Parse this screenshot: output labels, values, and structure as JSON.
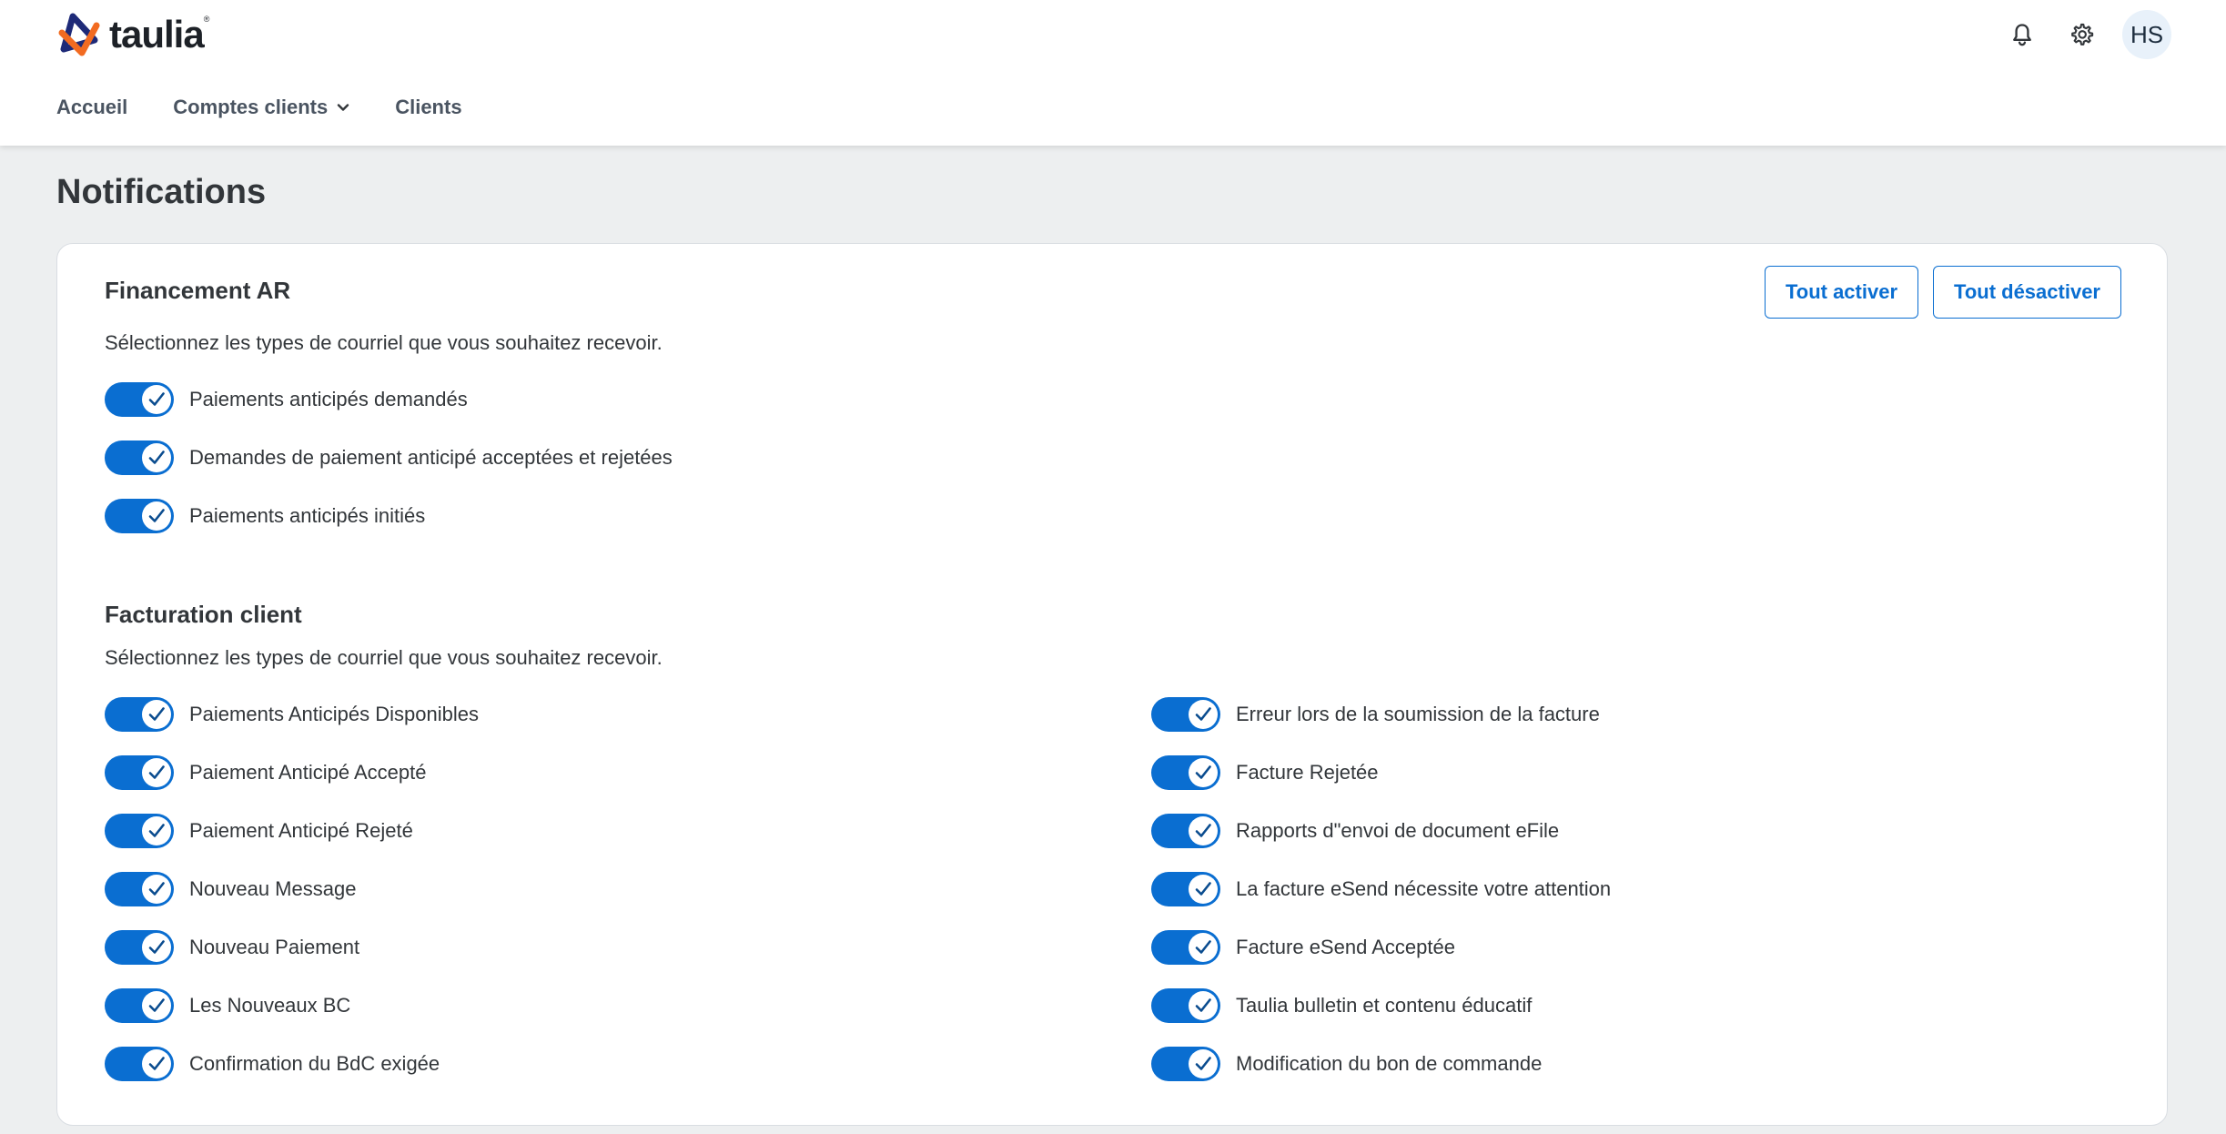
{
  "brand": {
    "name": "taulia",
    "mark": "®",
    "colors": {
      "orange": "#f26b21",
      "navy": "#1e2a78",
      "accent": "#0a6ed1"
    }
  },
  "header": {
    "bell_icon": "bell-icon",
    "settings_icon": "gear-icon",
    "avatar_initials": "HS"
  },
  "nav": {
    "items": [
      {
        "label": "Accueil"
      },
      {
        "label": "Comptes clients",
        "has_dropdown": true
      },
      {
        "label": "Clients"
      }
    ]
  },
  "page": {
    "title": "Notifications"
  },
  "actions": {
    "enable_all": "Tout activer",
    "disable_all": "Tout désactiver"
  },
  "sections": [
    {
      "title": "Financement AR",
      "description": "Sélectionnez les types de courriel que vous souhaitez recevoir.",
      "left": [
        {
          "label": "Paiements anticipés demandés",
          "enabled": true
        },
        {
          "label": "Demandes de paiement anticipé acceptées et rejetées",
          "enabled": true
        },
        {
          "label": "Paiements anticipés initiés",
          "enabled": true
        }
      ]
    },
    {
      "title": "Facturation client",
      "description": "Sélectionnez les types de courriel que vous souhaitez recevoir.",
      "left": [
        {
          "label": "Paiements Anticipés Disponibles",
          "enabled": true
        },
        {
          "label": "Paiement Anticipé Accepté",
          "enabled": true
        },
        {
          "label": "Paiement Anticipé Rejeté",
          "enabled": true
        },
        {
          "label": "Nouveau Message",
          "enabled": true
        },
        {
          "label": "Nouveau Paiement",
          "enabled": true
        },
        {
          "label": "Les Nouveaux BC",
          "enabled": true
        },
        {
          "label": "Confirmation du BdC exigée",
          "enabled": true
        }
      ],
      "right": [
        {
          "label": "Erreur lors de la soumission de la facture",
          "enabled": true
        },
        {
          "label": "Facture Rejetée",
          "enabled": true
        },
        {
          "label": "Rapports d\"envoi de document eFile",
          "enabled": true
        },
        {
          "label": "La facture eSend nécessite votre attention",
          "enabled": true
        },
        {
          "label": "Facture eSend Acceptée",
          "enabled": true
        },
        {
          "label": "Taulia bulletin et contenu éducatif",
          "enabled": true
        },
        {
          "label": "Modification du bon de commande",
          "enabled": true
        }
      ]
    }
  ]
}
